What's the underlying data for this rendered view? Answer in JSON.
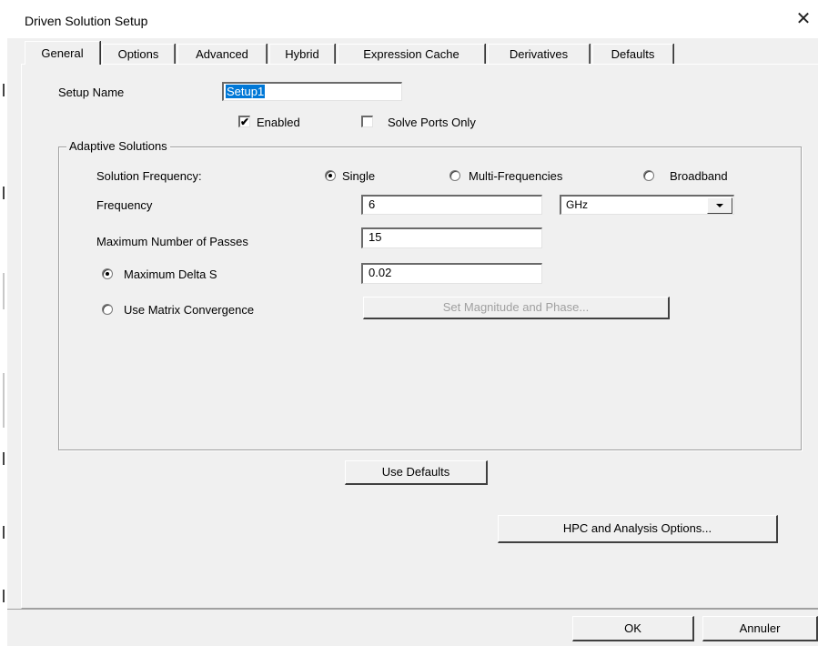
{
  "window": {
    "title": "Driven Solution Setup",
    "close_glyph": "✕"
  },
  "tabs": [
    {
      "label": "General",
      "active": true
    },
    {
      "label": "Options",
      "active": false
    },
    {
      "label": "Advanced",
      "active": false
    },
    {
      "label": "Hybrid",
      "active": false
    },
    {
      "label": "Expression Cache",
      "active": false
    },
    {
      "label": "Derivatives",
      "active": false
    },
    {
      "label": "Defaults",
      "active": false
    }
  ],
  "general": {
    "setup_name_label": "Setup Name",
    "setup_name_value": "Setup1",
    "enabled_label": "Enabled",
    "enabled_checked": true,
    "solve_ports_only_label": "Solve Ports Only",
    "solve_ports_only_checked": false,
    "check_glyph": "✔"
  },
  "adaptive": {
    "group_title": "Adaptive Solutions",
    "solution_frequency_label": "Solution Frequency:",
    "frequency_options": [
      {
        "label": "Single",
        "selected": true
      },
      {
        "label": "Multi-Frequencies",
        "selected": false
      },
      {
        "label": "Broadband",
        "selected": false
      }
    ],
    "frequency_label": "Frequency",
    "frequency_value": "6",
    "frequency_unit": "GHz",
    "max_passes_label": "Maximum Number of Passes",
    "max_passes_value": "15",
    "max_delta_s_label": "Maximum Delta S",
    "max_delta_s_selected": true,
    "max_delta_s_value": "0.02",
    "matrix_convergence_label": "Use Matrix Convergence",
    "matrix_convergence_selected": false,
    "set_mag_phase_label": "Set Magnitude and Phase..."
  },
  "buttons": {
    "use_defaults": "Use Defaults",
    "hpc_options": "HPC and Analysis Options...",
    "ok": "OK",
    "cancel": "Annuler"
  },
  "colors": {
    "dialog_bg": "#f0f0f0",
    "selection_highlight": "#0078d7",
    "disabled_text": "#a0a0a0"
  },
  "icons": {
    "close": "close-icon",
    "dropdown": "chevron-down-icon"
  }
}
